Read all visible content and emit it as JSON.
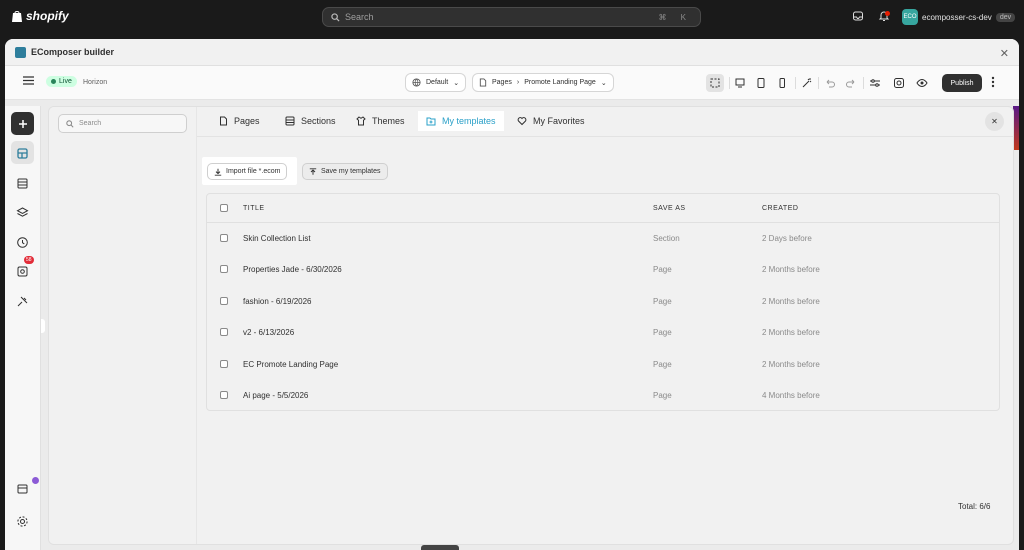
{
  "shopify": {
    "brand": "shopify",
    "search_placeholder": "Search",
    "shortcut": "⌘ K",
    "store_initials": "ECO",
    "store_name": "ecomposser-cs-dev",
    "store_tag": "dev"
  },
  "builder": {
    "window_title": "EComposer builder",
    "live_label": "Live",
    "theme_name": "Horizon",
    "device_select": "Default",
    "page_type": "Pages",
    "page_name": "Promote Landing Page",
    "publish_label": "Publish"
  },
  "rail": {
    "badge_count": "58"
  },
  "modal": {
    "search_placeholder": "Search",
    "tabs": [
      {
        "label": "Pages",
        "active": false
      },
      {
        "label": "Sections",
        "active": false
      },
      {
        "label": "Themes",
        "active": false
      },
      {
        "label": "My templates",
        "active": true
      },
      {
        "label": "My Favorites",
        "active": false
      }
    ],
    "import_button": "Import file *.ecom",
    "save_button": "Save my templates",
    "table": {
      "headers": {
        "title": "TITLE",
        "save_as": "SAVE AS",
        "created": "CREATED"
      },
      "rows": [
        {
          "title": "Skin Collection List",
          "save_as": "Section",
          "created": "2 Days before"
        },
        {
          "title": "Properties Jade - 6/30/2026",
          "save_as": "Page",
          "created": "2 Months before"
        },
        {
          "title": "fashion - 6/19/2026",
          "save_as": "Page",
          "created": "2 Months before"
        },
        {
          "title": "v2 - 6/13/2026",
          "save_as": "Page",
          "created": "2 Months before"
        },
        {
          "title": "EC Promote Landing Page",
          "save_as": "Page",
          "created": "2 Months before"
        },
        {
          "title": "Ai page - 5/5/2026",
          "save_as": "Page",
          "created": "4 Months before"
        }
      ]
    },
    "total": "Total: 6/6"
  },
  "colors": {
    "accent": "#2aa0c8",
    "live_bg": "#cdfee1",
    "badge": "#e22c38"
  }
}
